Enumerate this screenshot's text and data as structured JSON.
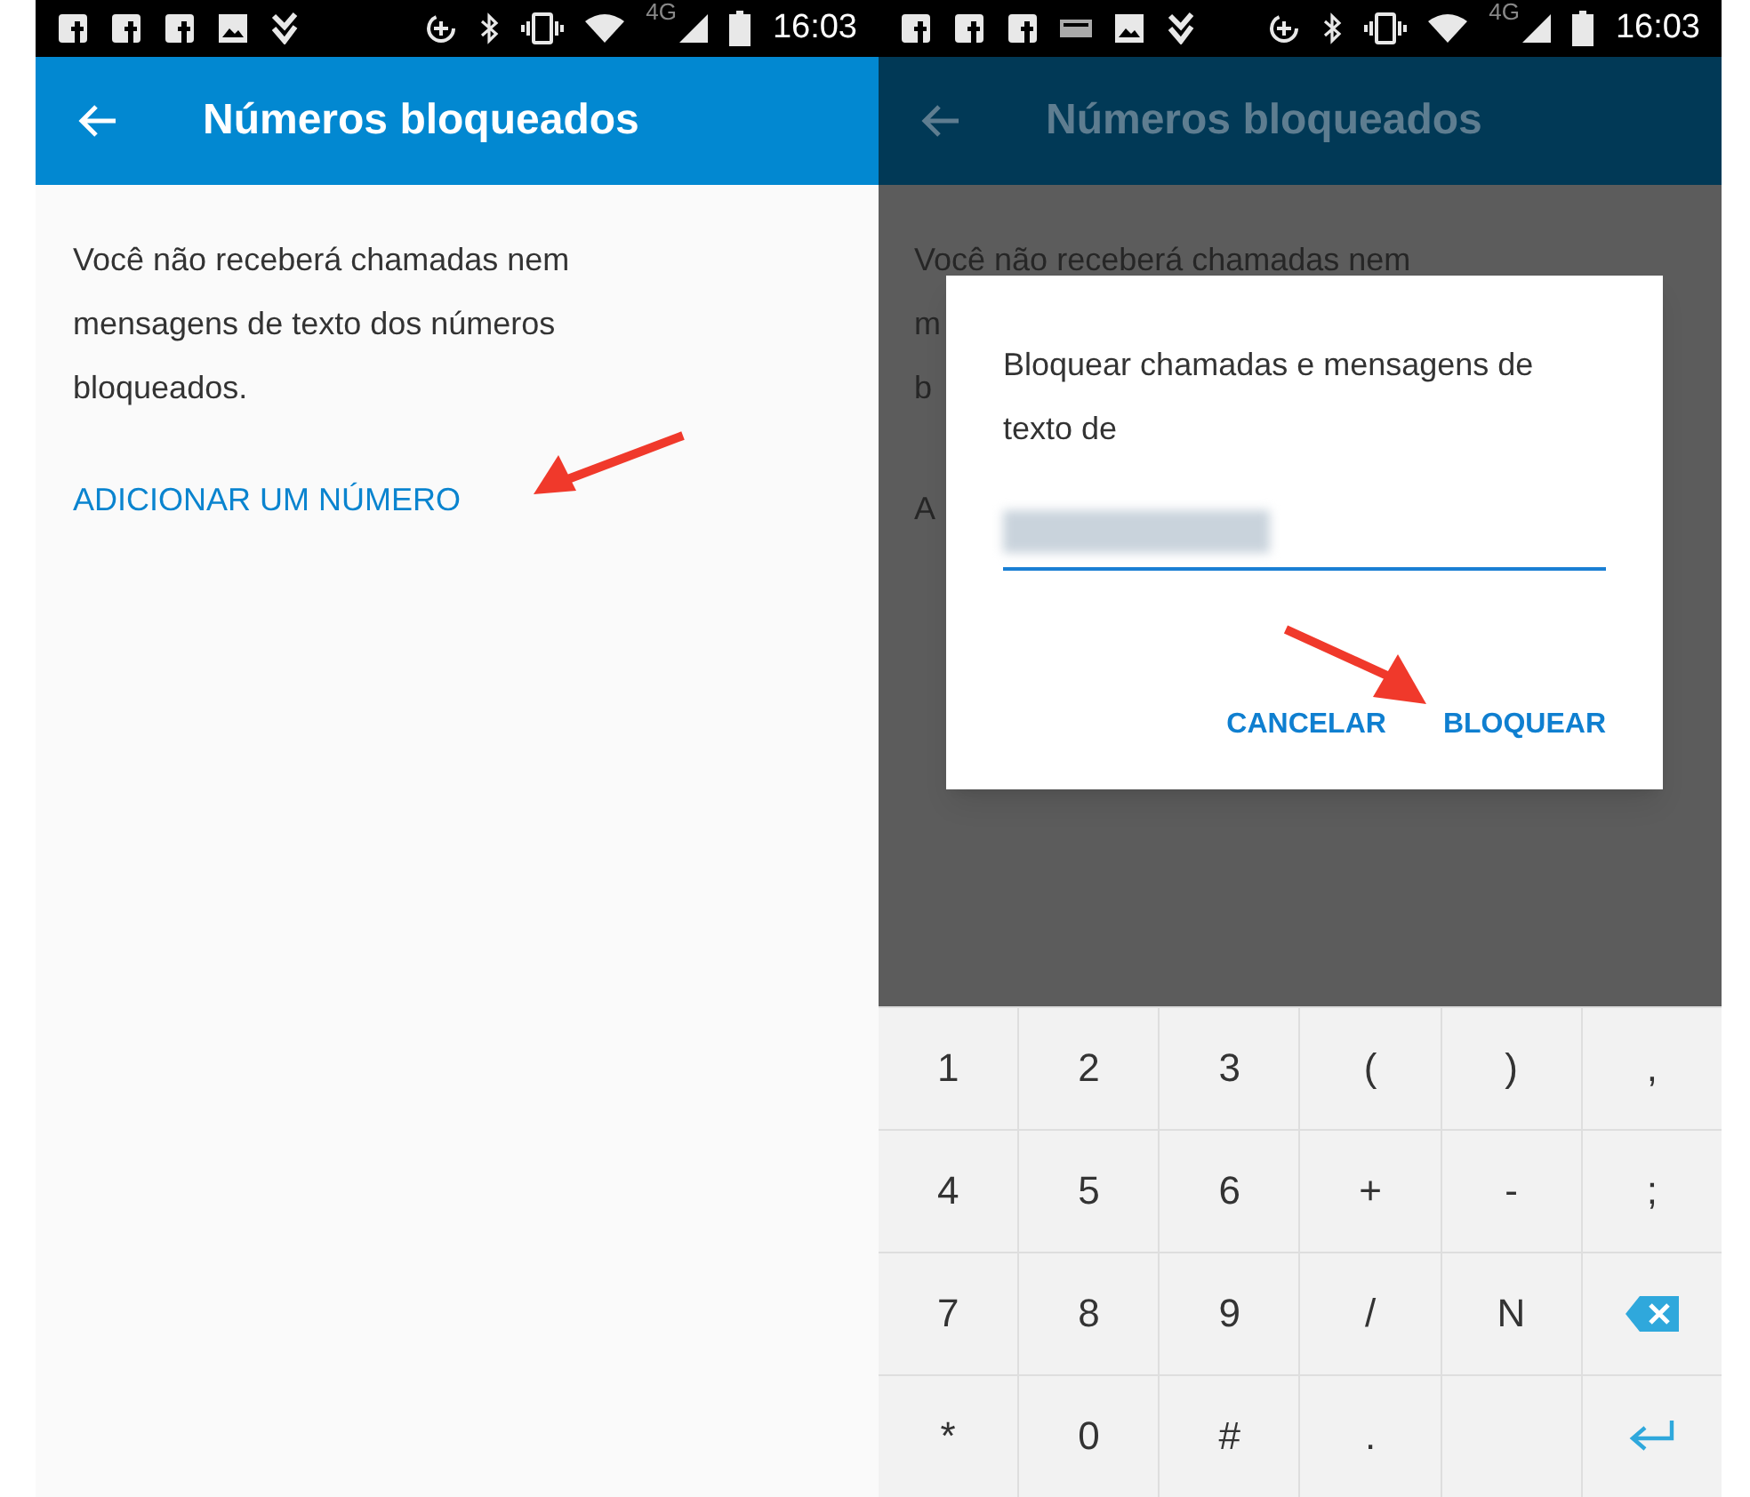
{
  "screens": [
    {
      "status_bar": {
        "network": "4G",
        "time": "16:03"
      },
      "app_bar": {
        "title": "Números bloqueados",
        "dimmed": false
      },
      "description": "Você não receberá chamadas nem mensagens de texto dos números bloqueados.",
      "add_link": "ADICIONAR UM NÚMERO"
    },
    {
      "status_bar": {
        "network": "4G",
        "time": "16:03"
      },
      "app_bar": {
        "title": "Números bloqueados",
        "dimmed": true
      },
      "background_lines": [
        "Você não receberá chamadas nem",
        "m",
        "b",
        "A"
      ],
      "dialog": {
        "message": "Bloquear chamadas e mensagens de texto de",
        "buttons": [
          "CANCELAR",
          "BLOQUEAR"
        ]
      },
      "keyboard": {
        "rows": [
          [
            {
              "kind": "char",
              "label": "1"
            },
            {
              "kind": "char",
              "label": "2"
            },
            {
              "kind": "char",
              "label": "3"
            },
            {
              "kind": "char",
              "label": "("
            },
            {
              "kind": "char",
              "label": ")"
            },
            {
              "kind": "char",
              "label": ","
            }
          ],
          [
            {
              "kind": "char",
              "label": "4"
            },
            {
              "kind": "char",
              "label": "5"
            },
            {
              "kind": "char",
              "label": "6"
            },
            {
              "kind": "char",
              "label": "+"
            },
            {
              "kind": "char",
              "label": "-"
            },
            {
              "kind": "char",
              "label": ";"
            }
          ],
          [
            {
              "kind": "char",
              "label": "7"
            },
            {
              "kind": "char",
              "label": "8"
            },
            {
              "kind": "char",
              "label": "9"
            },
            {
              "kind": "char",
              "label": "/"
            },
            {
              "kind": "char",
              "label": "N"
            },
            {
              "kind": "backspace"
            }
          ],
          [
            {
              "kind": "char",
              "label": "*"
            },
            {
              "kind": "char",
              "label": "0"
            },
            {
              "kind": "char",
              "label": "#"
            },
            {
              "kind": "char",
              "label": "."
            },
            {
              "kind": "blank"
            },
            {
              "kind": "enter"
            }
          ]
        ]
      }
    }
  ]
}
